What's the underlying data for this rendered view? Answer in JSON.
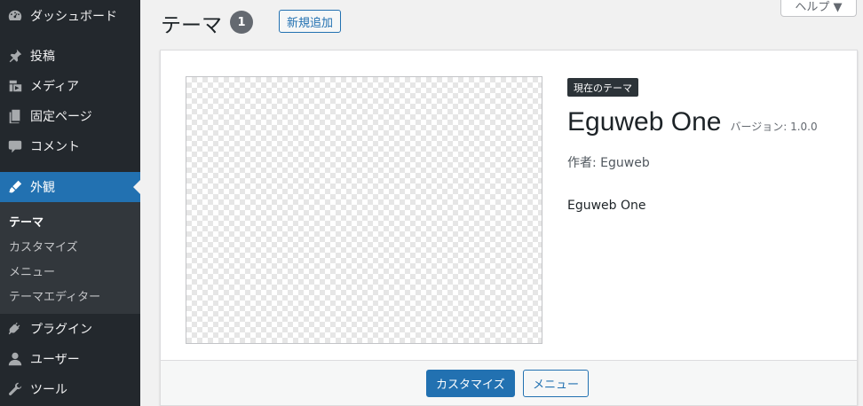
{
  "sidebar": {
    "items": [
      {
        "label": "ダッシュボード",
        "icon": "dashboard-icon"
      },
      {
        "label": "投稿",
        "icon": "pin-icon"
      },
      {
        "label": "メディア",
        "icon": "media-icon"
      },
      {
        "label": "固定ページ",
        "icon": "pages-icon"
      },
      {
        "label": "コメント",
        "icon": "comments-icon"
      },
      {
        "label": "外観",
        "icon": "appearance-icon"
      },
      {
        "label": "プラグイン",
        "icon": "plugins-icon"
      },
      {
        "label": "ユーザー",
        "icon": "users-icon"
      },
      {
        "label": "ツール",
        "icon": "tools-icon"
      }
    ],
    "submenu": [
      {
        "label": "テーマ"
      },
      {
        "label": "カスタマイズ"
      },
      {
        "label": "メニュー"
      },
      {
        "label": "テーマエディター"
      }
    ],
    "colors": {
      "background": "#23282d",
      "active": "#2271b1",
      "submenu": "#32373c"
    }
  },
  "header": {
    "title": "テーマ",
    "count": "1",
    "add_new_label": "新規追加",
    "help_label": "ヘルプ ▼"
  },
  "theme": {
    "badge": "現在のテーマ",
    "name": "Eguweb One",
    "version": "バージョン: 1.0.0",
    "author": "作者: Eguweb",
    "description": "Eguweb One"
  },
  "actions": {
    "customize_label": "カスタマイズ",
    "menus_label": "メニュー"
  }
}
